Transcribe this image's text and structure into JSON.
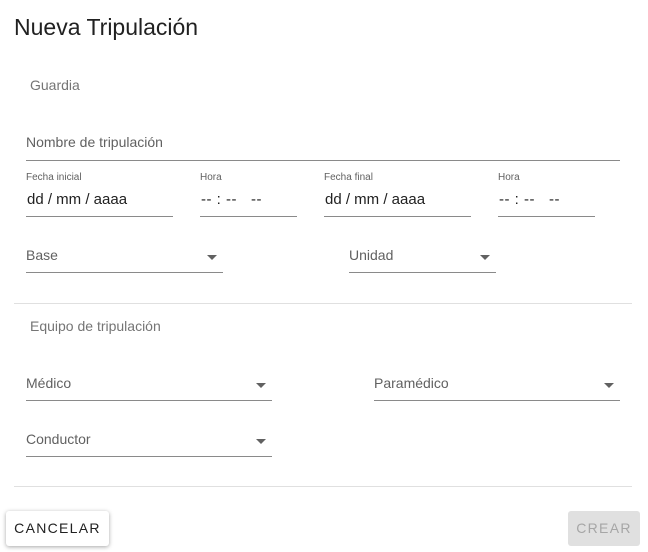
{
  "dialog": {
    "title": "Nueva Tripulación"
  },
  "guardia": {
    "section_label": "Guardia",
    "crew_name": {
      "placeholder": "Nombre de tripulación",
      "value": ""
    },
    "start_date": {
      "label": "Fecha inicial",
      "value": "dd / mm / aaaa"
    },
    "start_time": {
      "label": "Hora",
      "value": "-- : --   --"
    },
    "end_date": {
      "label": "Fecha final",
      "value": "dd / mm / aaaa"
    },
    "end_time": {
      "label": "Hora",
      "value": "-- : --   --"
    },
    "base": {
      "placeholder": "Base",
      "value": ""
    },
    "unidad": {
      "placeholder": "Unidad",
      "value": ""
    }
  },
  "equipo": {
    "section_label": "Equipo de tripulación",
    "medico": {
      "placeholder": "Médico",
      "value": ""
    },
    "paramedico": {
      "placeholder": "Paramédico",
      "value": ""
    },
    "conductor": {
      "placeholder": "Conductor",
      "value": ""
    }
  },
  "actions": {
    "cancel_label": "CANCELAR",
    "create_label": "CREAR",
    "create_disabled": true
  },
  "icons": {
    "dropdown": "caret-down-icon"
  }
}
